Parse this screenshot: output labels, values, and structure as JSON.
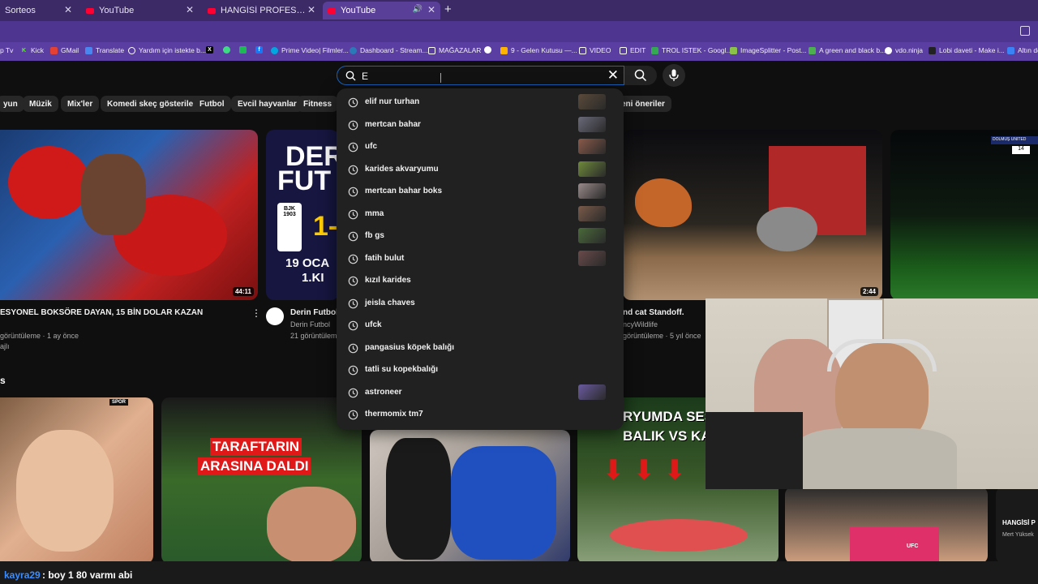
{
  "tabs": [
    {
      "title": "Sorteos"
    },
    {
      "title": "YouTube"
    },
    {
      "title": "HANGİSİ PROFESYONEL FUTBO"
    },
    {
      "title": "YouTube"
    }
  ],
  "new_tab": "+",
  "bookmarks": [
    {
      "label": "p Tv"
    },
    {
      "label": "Kick"
    },
    {
      "label": "GMail"
    },
    {
      "label": "Translate"
    },
    {
      "label": "Yardım için istekte b..."
    },
    {
      "label": "Prime Video| Filmler..."
    },
    {
      "label": "Dashboard - Stream..."
    },
    {
      "label": "MAĞAZALAR"
    },
    {
      "label": "9 - Gelen Kutusu —..."
    },
    {
      "label": "VIDEO"
    },
    {
      "label": "EDIT"
    },
    {
      "label": "TROL ISTEK - Googl..."
    },
    {
      "label": "ImageSplitter - Post..."
    },
    {
      "label": "A green and black b..."
    },
    {
      "label": "vdo.ninja"
    },
    {
      "label": "Lobi daveti - Make i..."
    },
    {
      "label": "Altın de"
    }
  ],
  "search": {
    "value": "E"
  },
  "chips": [
    "yun",
    "Müzik",
    "Mix'ler",
    "Komedi skeç gösterileri",
    "Futbol",
    "Evcil hayvanlar",
    "Fitness",
    "eni öneriler"
  ],
  "suggestions": [
    {
      "text": "elif nur turhan",
      "thumb": true,
      "color": "#5a4a3a"
    },
    {
      "text": "mertcan bahar",
      "thumb": true,
      "color": "#6a6a7a"
    },
    {
      "text": "ufc",
      "thumb": true,
      "color": "#8a5a4a"
    },
    {
      "text": "karides akvaryumu",
      "thumb": true,
      "color": "#6f8a3a"
    },
    {
      "text": "mertcan bahar boks",
      "thumb": true,
      "color": "#9a8a8a"
    },
    {
      "text": "mma",
      "thumb": true,
      "color": "#7a5a4a"
    },
    {
      "text": "fb gs",
      "thumb": true,
      "color": "#4a6a3a"
    },
    {
      "text": "fatih bulut",
      "thumb": true,
      "color": "#6a4a4a"
    },
    {
      "text": "kızıl karides",
      "thumb": false
    },
    {
      "text": "jeisla chaves",
      "thumb": false
    },
    {
      "text": "ufck",
      "thumb": false
    },
    {
      "text": "pangasius köpek balığı",
      "thumb": false
    },
    {
      "text": "tatli su kopekbalığı",
      "thumb": false
    },
    {
      "text": "astroneer",
      "thumb": true,
      "color": "#6a5aa0"
    },
    {
      "text": "thermomix tm7",
      "thumb": false
    }
  ],
  "videos_row1": [
    {
      "title": "ESYONEL BOKSÖRE DAYAN, 15 BİN DOLAR KAZAN",
      "meta1": "görüntüleme · 1 ay önce",
      "meta2": "ajlı",
      "duration": "44:11"
    },
    {
      "title": "Derin Futbol",
      "channel": "Derin Futbol",
      "meta1": "21 görüntülem",
      "thumb_big": "DER",
      "thumb_big2": "FUT",
      "thumb_score": "1-",
      "thumb_date": "19 OCA",
      "thumb_sub": "1.KI",
      "badge": "BJK 1903"
    },
    {
      "title": "nd cat Standoff.",
      "channel": "ncyWildlife",
      "meta1": "görüntüleme · 5 yıl önce",
      "duration": "2:44"
    },
    {
      "thumb_badge": "DOLMUŞ UNITED",
      "thumb_score": "14"
    }
  ],
  "videos_row2": [
    {
      "thumb_tag": "SPOR"
    },
    {
      "thumb_text1": "TARAFTARIN",
      "thumb_text2": "ARASINA DALDI"
    },
    {},
    {
      "thumb_text1": "RYUMDA SESS",
      "thumb_text2": "BALIK VS KAR"
    },
    {
      "thumb_text1": "UFC"
    },
    {
      "thumb_text1": "HANGİSİ P",
      "thumb_text2": "Mert Yüksek"
    }
  ],
  "chat": {
    "user": "kayra29",
    "message": ": boy 1 80 varmı abi"
  }
}
